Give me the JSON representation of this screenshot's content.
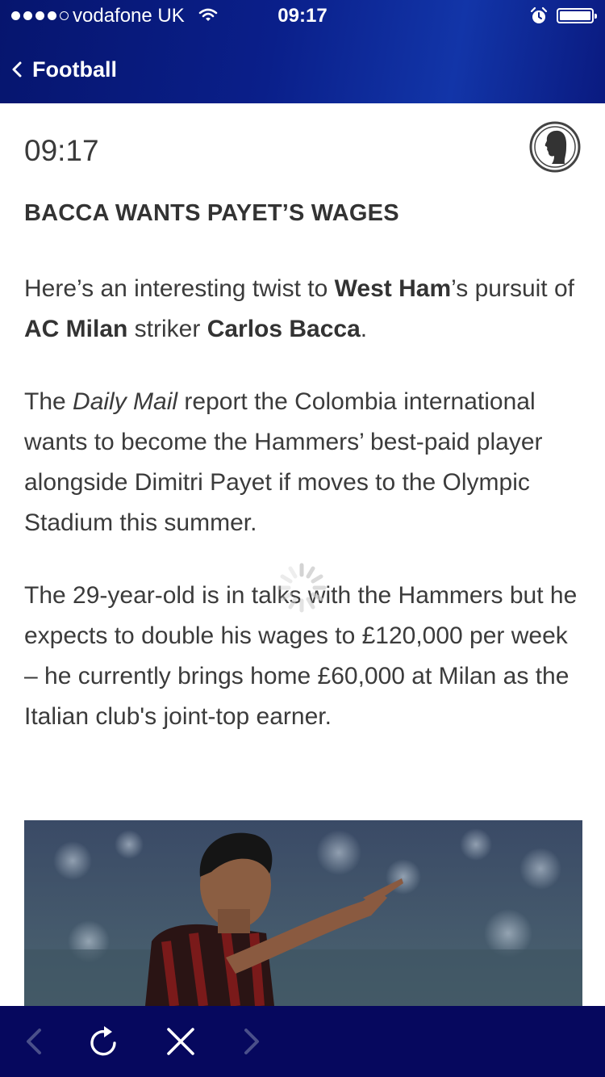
{
  "status_bar": {
    "carrier": "vodafone UK",
    "time": "09:17"
  },
  "nav": {
    "back_label": "Football"
  },
  "article": {
    "time": "09:17",
    "headline": "BACCA WANTS PAYET’S WAGES",
    "p1": {
      "t1": "Here’s an interesting twist to ",
      "b1": "West Ham",
      "t2": "’s pursuit of ",
      "b2": "AC Milan",
      "t3": " striker ",
      "b3": "Carlos Bacca",
      "t4": "."
    },
    "p2": {
      "t1": "The ",
      "i1": "Daily Mail",
      "t2": " report the Colombia international wants to become the Hammers’ best-paid player alongside Dimitri Payet if moves to the Olympic Stadium this summer."
    },
    "p3": "The 29-year-old is in talks with the Hammers but he expects to double his wages to £120,000 per week – he currently brings home £60,000 at Milan as the Italian club's joint-top earner."
  },
  "icons": {
    "back": "chevron-left-icon",
    "badge": "sky-sports-badge-icon",
    "loading": "loading-spinner-icon",
    "toolbar_back": "arrow-left-icon",
    "toolbar_refresh": "refresh-icon",
    "toolbar_close": "close-icon",
    "toolbar_forward": "arrow-right-icon"
  },
  "colors": {
    "header": "#0a1f8a",
    "toolbar": "#06085e",
    "text": "#3b3b3b"
  }
}
